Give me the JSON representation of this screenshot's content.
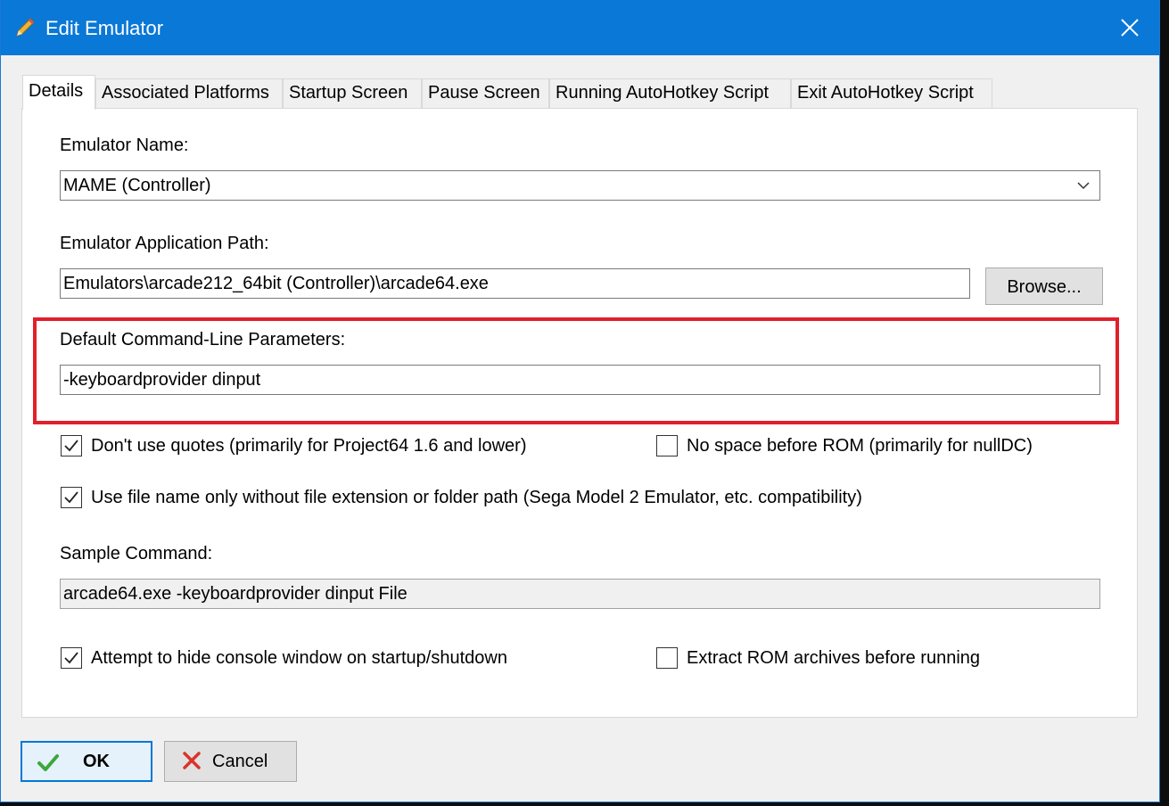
{
  "window": {
    "title": "Edit Emulator",
    "accent": "#0a78d7"
  },
  "tabs": [
    {
      "label": "Details",
      "active": true
    },
    {
      "label": "Associated Platforms",
      "active": false
    },
    {
      "label": "Startup Screen",
      "active": false
    },
    {
      "label": "Pause Screen",
      "active": false
    },
    {
      "label": "Running AutoHotkey Script",
      "active": false
    },
    {
      "label": "Exit AutoHotkey Script",
      "active": false
    }
  ],
  "details": {
    "emulator_name_label": "Emulator Name:",
    "emulator_name_value": "MAME (Controller)",
    "app_path_label": "Emulator Application Path:",
    "app_path_value": "Emulators\\arcade212_64bit (Controller)\\arcade64.exe",
    "browse_label": "Browse...",
    "cmd_params_label": "Default Command-Line Parameters:",
    "cmd_params_value": "-keyboardprovider dinput",
    "highlight_color": "#e0202b",
    "options": {
      "no_quotes": {
        "label": "Don't use quotes (primarily for Project64 1.6 and lower)",
        "checked": true
      },
      "no_space": {
        "label": "No space before ROM (primarily for nullDC)",
        "checked": false
      },
      "file_name_only": {
        "label": "Use file name only without file extension or folder path (Sega Model 2 Emulator, etc. compatibility)",
        "checked": true
      },
      "hide_console": {
        "label": "Attempt to hide console window on startup/shutdown",
        "checked": true
      },
      "extract_rom": {
        "label": "Extract ROM archives before running",
        "checked": false
      }
    },
    "sample_command_label": "Sample Command:",
    "sample_command_value": "arcade64.exe -keyboardprovider dinput File"
  },
  "buttons": {
    "ok_label": "OK",
    "cancel_label": "Cancel"
  },
  "icons": {
    "app": "pencil-icon",
    "close": "close-icon",
    "ok": "checkmark-icon",
    "cancel": "red-x-icon"
  }
}
